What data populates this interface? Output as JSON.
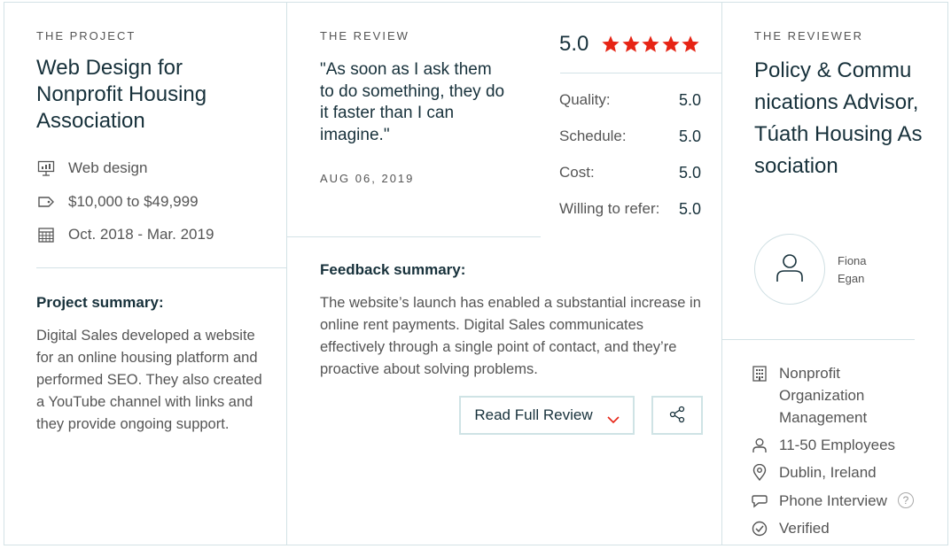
{
  "colors": {
    "star": "#e62415",
    "border": "#d3e2e6",
    "text_dark": "#17313b",
    "text_muted": "#555555"
  },
  "project": {
    "eyebrow": "THE PROJECT",
    "title": "Web Design for Nonprofit Housing Association",
    "service": {
      "icon": "presentation-icon",
      "text": "Web design"
    },
    "budget": {
      "icon": "price-tag-icon",
      "text": "$10,000 to $49,999"
    },
    "dates": {
      "icon": "calendar-icon",
      "text": "Oct. 2018 - Mar. 2019"
    },
    "summary_heading": "Project summary:",
    "summary_text": "Digital Sales developed a website for an online housing platform and performed SEO. They also created a YouTube channel with links and they provide ongoing support."
  },
  "review": {
    "eyebrow": "THE REVIEW",
    "quote": "\"As soon as I ask them to do something, they do it faster than I can imagine.\"",
    "date": "AUG 06, 2019",
    "overall_score": "5.0",
    "overall_rating": 5,
    "scores": [
      {
        "label": "Quality:",
        "value": "5.0"
      },
      {
        "label": "Schedule:",
        "value": "5.0"
      },
      {
        "label": "Cost:",
        "value": "5.0"
      },
      {
        "label": "Willing to refer:",
        "value": "5.0"
      }
    ],
    "feedback_heading": "Feedback summary:",
    "feedback_text": "The website’s launch has enabled a substantial increase in online rent payments. Digital Sales communicates effectively through a single point of contact, and they’re proactive about solving problems.",
    "read_full_label": "Read Full Review",
    "share_icon": "share-icon"
  },
  "reviewer": {
    "eyebrow": "THE REVIEWER",
    "title": "Policy & Communications Advisor, Túath Housing Association",
    "name": "Fiona Egan",
    "industry": {
      "icon": "building-icon",
      "text": "Nonprofit Organization Management"
    },
    "size": {
      "icon": "user-icon",
      "text": "11-50 Employees"
    },
    "location": {
      "icon": "location-pin-icon",
      "text": "Dublin, Ireland"
    },
    "interview": {
      "icon": "chat-bubble-icon",
      "text": "Phone Interview",
      "help": "?"
    },
    "verified": {
      "icon": "check-circle-icon",
      "text": "Verified"
    }
  }
}
